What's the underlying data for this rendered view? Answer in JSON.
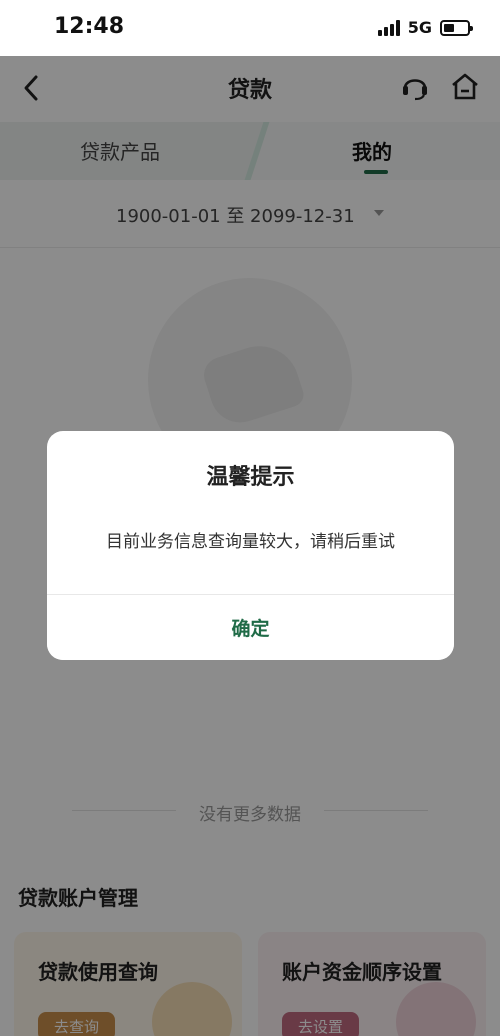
{
  "status_bar": {
    "time": "12:48",
    "network": "5G",
    "battery_level": 0.45
  },
  "nav": {
    "title": "贷款",
    "back_icon": "chevron-left-icon",
    "service_icon": "headset-icon",
    "home_icon": "home-icon"
  },
  "tabs": [
    {
      "label": "贷款产品",
      "active": false
    },
    {
      "label": "我的",
      "active": true
    }
  ],
  "date_filter": {
    "range": "1900-01-01 至 2099-12-31"
  },
  "empty_state": {
    "no_more_text": "没有更多数据"
  },
  "account_management": {
    "title": "贷款账户管理",
    "cards": [
      {
        "title": "贷款使用查询",
        "button": "去查询"
      },
      {
        "title": "账户资金顺序设置",
        "button": "去设置"
      }
    ]
  },
  "dialog": {
    "title": "温馨提示",
    "message": "目前业务信息查询量较大，请稍后重试",
    "confirm": "确定"
  },
  "colors": {
    "accent": "#1f6b47",
    "mask": "rgba(0,0,0,0.45)"
  }
}
